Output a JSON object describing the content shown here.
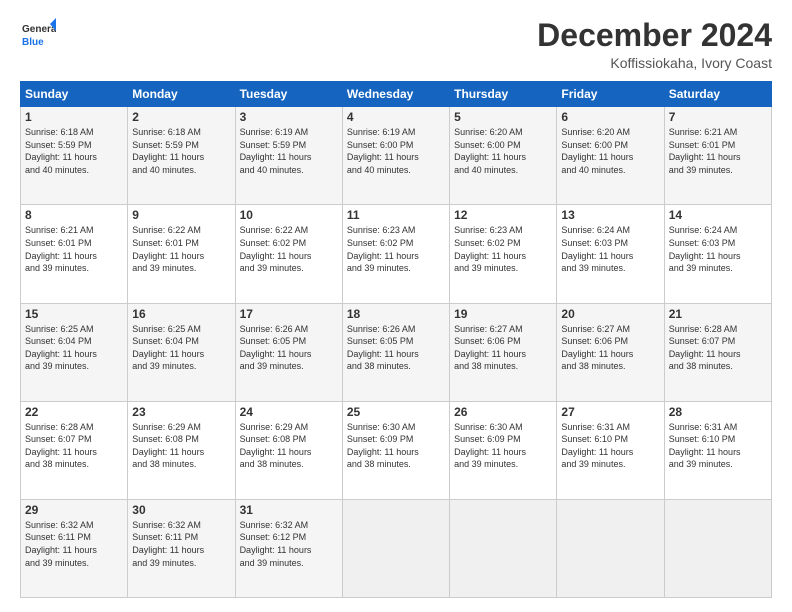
{
  "logo": {
    "line1": "General",
    "line2": "Blue"
  },
  "title": "December 2024",
  "subtitle": "Koffissiokaha, Ivory Coast",
  "days_header": [
    "Sunday",
    "Monday",
    "Tuesday",
    "Wednesday",
    "Thursday",
    "Friday",
    "Saturday"
  ],
  "weeks": [
    [
      {
        "day": "1",
        "info": "Sunrise: 6:18 AM\nSunset: 5:59 PM\nDaylight: 11 hours\nand 40 minutes."
      },
      {
        "day": "2",
        "info": "Sunrise: 6:18 AM\nSunset: 5:59 PM\nDaylight: 11 hours\nand 40 minutes."
      },
      {
        "day": "3",
        "info": "Sunrise: 6:19 AM\nSunset: 5:59 PM\nDaylight: 11 hours\nand 40 minutes."
      },
      {
        "day": "4",
        "info": "Sunrise: 6:19 AM\nSunset: 6:00 PM\nDaylight: 11 hours\nand 40 minutes."
      },
      {
        "day": "5",
        "info": "Sunrise: 6:20 AM\nSunset: 6:00 PM\nDaylight: 11 hours\nand 40 minutes."
      },
      {
        "day": "6",
        "info": "Sunrise: 6:20 AM\nSunset: 6:00 PM\nDaylight: 11 hours\nand 40 minutes."
      },
      {
        "day": "7",
        "info": "Sunrise: 6:21 AM\nSunset: 6:01 PM\nDaylight: 11 hours\nand 39 minutes."
      }
    ],
    [
      {
        "day": "8",
        "info": "Sunrise: 6:21 AM\nSunset: 6:01 PM\nDaylight: 11 hours\nand 39 minutes."
      },
      {
        "day": "9",
        "info": "Sunrise: 6:22 AM\nSunset: 6:01 PM\nDaylight: 11 hours\nand 39 minutes."
      },
      {
        "day": "10",
        "info": "Sunrise: 6:22 AM\nSunset: 6:02 PM\nDaylight: 11 hours\nand 39 minutes."
      },
      {
        "day": "11",
        "info": "Sunrise: 6:23 AM\nSunset: 6:02 PM\nDaylight: 11 hours\nand 39 minutes."
      },
      {
        "day": "12",
        "info": "Sunrise: 6:23 AM\nSunset: 6:02 PM\nDaylight: 11 hours\nand 39 minutes."
      },
      {
        "day": "13",
        "info": "Sunrise: 6:24 AM\nSunset: 6:03 PM\nDaylight: 11 hours\nand 39 minutes."
      },
      {
        "day": "14",
        "info": "Sunrise: 6:24 AM\nSunset: 6:03 PM\nDaylight: 11 hours\nand 39 minutes."
      }
    ],
    [
      {
        "day": "15",
        "info": "Sunrise: 6:25 AM\nSunset: 6:04 PM\nDaylight: 11 hours\nand 39 minutes."
      },
      {
        "day": "16",
        "info": "Sunrise: 6:25 AM\nSunset: 6:04 PM\nDaylight: 11 hours\nand 39 minutes."
      },
      {
        "day": "17",
        "info": "Sunrise: 6:26 AM\nSunset: 6:05 PM\nDaylight: 11 hours\nand 39 minutes."
      },
      {
        "day": "18",
        "info": "Sunrise: 6:26 AM\nSunset: 6:05 PM\nDaylight: 11 hours\nand 38 minutes."
      },
      {
        "day": "19",
        "info": "Sunrise: 6:27 AM\nSunset: 6:06 PM\nDaylight: 11 hours\nand 38 minutes."
      },
      {
        "day": "20",
        "info": "Sunrise: 6:27 AM\nSunset: 6:06 PM\nDaylight: 11 hours\nand 38 minutes."
      },
      {
        "day": "21",
        "info": "Sunrise: 6:28 AM\nSunset: 6:07 PM\nDaylight: 11 hours\nand 38 minutes."
      }
    ],
    [
      {
        "day": "22",
        "info": "Sunrise: 6:28 AM\nSunset: 6:07 PM\nDaylight: 11 hours\nand 38 minutes."
      },
      {
        "day": "23",
        "info": "Sunrise: 6:29 AM\nSunset: 6:08 PM\nDaylight: 11 hours\nand 38 minutes."
      },
      {
        "day": "24",
        "info": "Sunrise: 6:29 AM\nSunset: 6:08 PM\nDaylight: 11 hours\nand 38 minutes."
      },
      {
        "day": "25",
        "info": "Sunrise: 6:30 AM\nSunset: 6:09 PM\nDaylight: 11 hours\nand 38 minutes."
      },
      {
        "day": "26",
        "info": "Sunrise: 6:30 AM\nSunset: 6:09 PM\nDaylight: 11 hours\nand 39 minutes."
      },
      {
        "day": "27",
        "info": "Sunrise: 6:31 AM\nSunset: 6:10 PM\nDaylight: 11 hours\nand 39 minutes."
      },
      {
        "day": "28",
        "info": "Sunrise: 6:31 AM\nSunset: 6:10 PM\nDaylight: 11 hours\nand 39 minutes."
      }
    ],
    [
      {
        "day": "29",
        "info": "Sunrise: 6:32 AM\nSunset: 6:11 PM\nDaylight: 11 hours\nand 39 minutes."
      },
      {
        "day": "30",
        "info": "Sunrise: 6:32 AM\nSunset: 6:11 PM\nDaylight: 11 hours\nand 39 minutes."
      },
      {
        "day": "31",
        "info": "Sunrise: 6:32 AM\nSunset: 6:12 PM\nDaylight: 11 hours\nand 39 minutes."
      },
      {
        "day": "",
        "info": ""
      },
      {
        "day": "",
        "info": ""
      },
      {
        "day": "",
        "info": ""
      },
      {
        "day": "",
        "info": ""
      }
    ]
  ]
}
